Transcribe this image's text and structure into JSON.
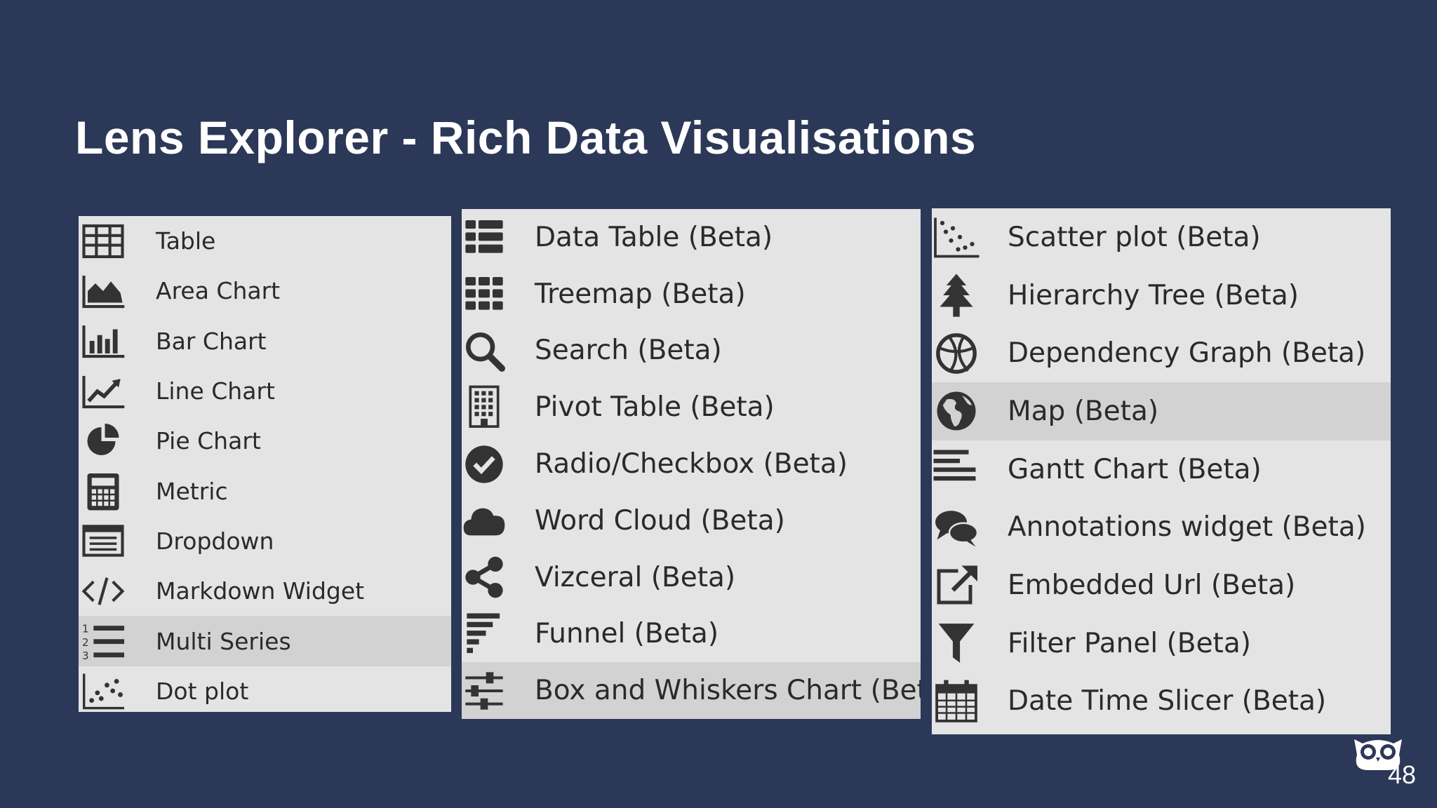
{
  "slide": {
    "title": "Lens Explorer - Rich Data Visualisations",
    "page_number": "48"
  },
  "panels": [
    {
      "items": [
        {
          "label": "Table",
          "icon": "table-icon"
        },
        {
          "label": "Area Chart",
          "icon": "area-chart-icon"
        },
        {
          "label": "Bar Chart",
          "icon": "bar-chart-icon"
        },
        {
          "label": "Line Chart",
          "icon": "line-chart-icon"
        },
        {
          "label": "Pie Chart",
          "icon": "pie-chart-icon"
        },
        {
          "label": "Metric",
          "icon": "calculator-icon"
        },
        {
          "label": "Dropdown",
          "icon": "dropdown-list-icon"
        },
        {
          "label": "Markdown Widget",
          "icon": "code-icon"
        },
        {
          "label": "Multi Series",
          "icon": "numbered-list-icon",
          "selected": true
        },
        {
          "label": "Dot plot",
          "icon": "dot-plot-icon"
        }
      ]
    },
    {
      "items": [
        {
          "label": "Data Table (Beta)",
          "icon": "data-table-icon"
        },
        {
          "label": "Treemap (Beta)",
          "icon": "treemap-icon"
        },
        {
          "label": "Search (Beta)",
          "icon": "search-icon"
        },
        {
          "label": "Pivot Table (Beta)",
          "icon": "pivot-table-icon"
        },
        {
          "label": "Radio/Checkbox (Beta)",
          "icon": "check-circle-icon"
        },
        {
          "label": "Word Cloud (Beta)",
          "icon": "cloud-icon"
        },
        {
          "label": "Vizceral (Beta)",
          "icon": "share-nodes-icon"
        },
        {
          "label": "Funnel (Beta)",
          "icon": "funnel-bars-icon"
        },
        {
          "label": "Box and Whiskers Chart (Beta)",
          "icon": "sliders-icon",
          "selected": true
        }
      ]
    },
    {
      "items": [
        {
          "label": "Scatter plot (Beta)",
          "icon": "scatter-plot-icon"
        },
        {
          "label": "Hierarchy Tree (Beta)",
          "icon": "tree-icon"
        },
        {
          "label": "Dependency Graph (Beta)",
          "icon": "dependency-graph-icon"
        },
        {
          "label": "Map (Beta)",
          "icon": "globe-icon",
          "selected": true
        },
        {
          "label": "Gantt Chart (Beta)",
          "icon": "gantt-icon"
        },
        {
          "label": "Annotations widget (Beta)",
          "icon": "comments-icon"
        },
        {
          "label": "Embedded Url (Beta)",
          "icon": "external-link-icon"
        },
        {
          "label": "Filter Panel (Beta)",
          "icon": "filter-icon"
        },
        {
          "label": "Date Time Slicer (Beta)",
          "icon": "calendar-icon"
        }
      ]
    }
  ],
  "colors": {
    "background": "#2c3858",
    "panel": "#e4e4e4",
    "selected_row": "#d2d2d2",
    "icon": "#333333",
    "text": "#2a2a2a"
  }
}
